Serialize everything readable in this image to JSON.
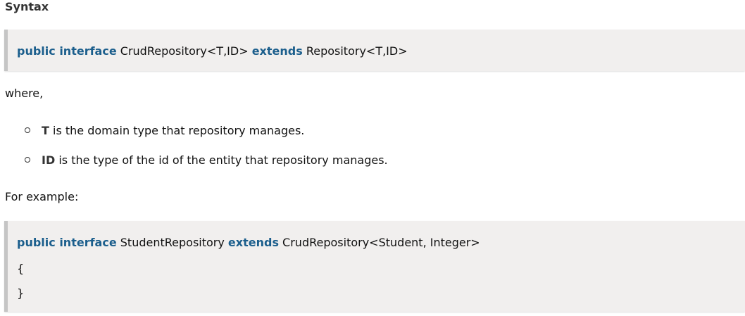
{
  "heading": "Syntax",
  "syntax_code": {
    "kw1": "public interface",
    "text1": " CrudRepository<T,ID> ",
    "kw2": "extends",
    "text2": " Repository<T,ID>"
  },
  "where_text": "where,",
  "definitions": [
    {
      "term": "T",
      "desc": " is the domain type that repository manages."
    },
    {
      "term": "ID",
      "desc": " is the type of the id of the entity that repository manages."
    }
  ],
  "example_label": "For example:",
  "example_code": {
    "kw1": "public interface",
    "text1": " StudentRepository ",
    "kw2": "extends",
    "text2": " CrudRepository<Student, Integer>",
    "line2": "{",
    "line3": "}"
  },
  "colors": {
    "keyword": "#1b5e8c",
    "code_bg": "#f1efee",
    "code_border": "#c5c5c5"
  }
}
